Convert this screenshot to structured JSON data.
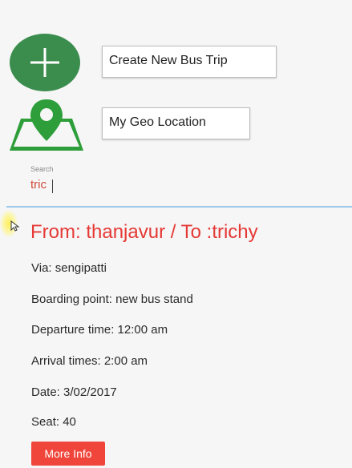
{
  "actions": {
    "create_trip_label": "Create New Bus Trip",
    "geo_location_label": "My Geo Location"
  },
  "search": {
    "label": "Search",
    "value": "tric"
  },
  "trip": {
    "title": "From: thanjavur / To :trichy",
    "via": "Via: sengipatti",
    "boarding": "Boarding point: new bus stand",
    "departure": "Departure time: 12:00 am",
    "arrival": "Arrival times: 2:00 am",
    "date": "Date: 3/02/2017",
    "seat": "Seat: 40",
    "more_info_label": "More Info"
  },
  "icons": {
    "create": "plus-circle-icon",
    "geo": "map-location-pin-icon",
    "cursor": "mouse-pointer-icon"
  },
  "colors": {
    "accent_green": "#3b8d4e",
    "title_red": "#e53935",
    "button_red": "#f0453a",
    "divider_blue": "#9ec9e8"
  }
}
